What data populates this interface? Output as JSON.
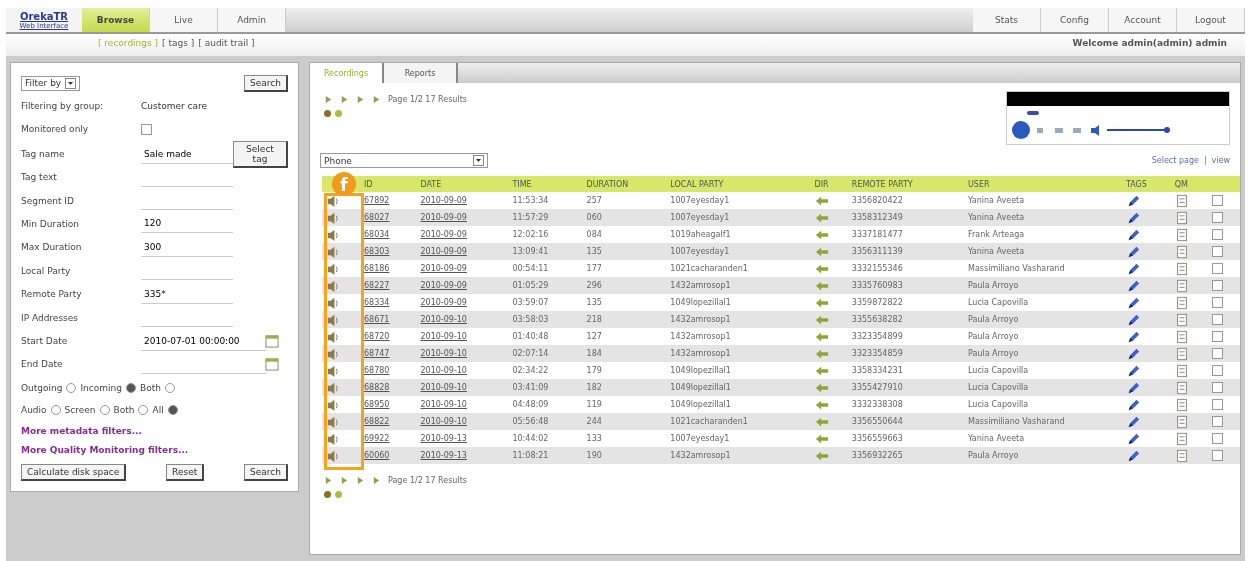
{
  "logo": {
    "name": "OrekaTR",
    "subtitle": "Web Interface"
  },
  "main_tabs": [
    {
      "label": "Browse",
      "selected": true
    },
    {
      "label": "Live",
      "selected": false
    },
    {
      "label": "Admin",
      "selected": false
    }
  ],
  "right_tabs": [
    {
      "label": "Stats"
    },
    {
      "label": "Config"
    },
    {
      "label": "Account"
    },
    {
      "label": "Logout"
    }
  ],
  "sub_nav": [
    {
      "label": "[ recordings ]",
      "selected": true
    },
    {
      "label": "[ tags ]",
      "selected": false
    },
    {
      "label": "[ audit trail ]",
      "selected": false
    }
  ],
  "welcome": "Welcome admin(admin) admin",
  "filter_panel": {
    "filter_select": "Filter by",
    "search_button": "Search",
    "fields": [
      {
        "kind": "text",
        "label": "Filtering by group:",
        "value": "Customer care"
      },
      {
        "kind": "checkbox",
        "label": "Monitored only",
        "checked": false
      },
      {
        "kind": "input",
        "label": "Tag name",
        "value": "Sale made",
        "button": "Select tag"
      },
      {
        "kind": "input",
        "label": "Tag text"
      },
      {
        "kind": "input",
        "label": "Segment ID"
      },
      {
        "kind": "input",
        "label": "Min Duration",
        "value": "120"
      },
      {
        "kind": "input",
        "label": "Max Duration",
        "value": "300"
      },
      {
        "kind": "input",
        "label": "Local Party"
      },
      {
        "kind": "input",
        "label": "Remote Party",
        "value": "335*"
      },
      {
        "kind": "input",
        "label": "IP Addresses"
      },
      {
        "kind": "date",
        "label": "Start Date",
        "value": "2010-07-01 00:00:00"
      },
      {
        "kind": "date",
        "label": "End Date"
      }
    ],
    "direction": [
      {
        "label": "Outgoing",
        "selected": false
      },
      {
        "label": "Incoming",
        "selected": true
      },
      {
        "label": "Both",
        "selected": false
      }
    ],
    "media": [
      {
        "label": "Audio",
        "selected": false
      },
      {
        "label": "Screen",
        "selected": false
      },
      {
        "label": "Both",
        "selected": false
      },
      {
        "label": "All",
        "selected": true
      }
    ],
    "links": [
      "More metadata filters...",
      "More Quality Monitoring filters..."
    ],
    "buttons": [
      "Calculate disk space",
      "Reset",
      "Search"
    ]
  },
  "content_tabs": [
    {
      "label": "Recordings",
      "selected": true
    },
    {
      "label": "Reports",
      "selected": false
    }
  ],
  "pagination_top": "Page 1/2 17 Results",
  "pagination_bottom": "Page 1/2 17 Results",
  "view_select": "Phone",
  "table_links": [
    "Select page",
    "view"
  ],
  "link_separator": "|",
  "callout": "f",
  "table": {
    "columns": [
      "",
      "ID",
      "DATE",
      "TIME",
      "DURATION",
      "LOCAL PARTY",
      "DIR",
      "REMOTE PARTY",
      "USER",
      "TAGS",
      "QM",
      ""
    ],
    "rows": [
      {
        "cells": [
          "",
          "67892",
          "2010-09-09",
          "11:53:34",
          "257",
          "1007eyesday1",
          "",
          "3356820422",
          "Yanina Aveeta",
          "",
          "",
          ""
        ],
        "checked": false
      },
      {
        "cells": [
          "",
          "68027",
          "2010-09-09",
          "11:57:29",
          "060",
          "1007eyesday1",
          "",
          "3358312349",
          "Yanina Aveeta",
          "",
          "",
          ""
        ],
        "checked": false
      },
      {
        "cells": [
          "",
          "68034",
          "2010-09-09",
          "12:02:16",
          "084",
          "1019aheagalf1",
          "",
          "3337181477",
          "Frank Arteaga",
          "",
          "",
          ""
        ],
        "checked": false
      },
      {
        "cells": [
          "",
          "68303",
          "2010-09-09",
          "13:09:41",
          "135",
          "1007eyesday1",
          "",
          "3356311139",
          "Yanina Aveeta",
          "",
          "",
          ""
        ],
        "checked": false
      },
      {
        "cells": [
          "",
          "68186",
          "2010-09-09",
          "00:54:11",
          "177",
          "1021cacharanden1",
          "",
          "3332155346",
          "Massimiliano Vasharand",
          "",
          "",
          ""
        ],
        "checked": false
      },
      {
        "cells": [
          "",
          "68227",
          "2010-09-09",
          "01:05:29",
          "296",
          "1432amrosop1",
          "",
          "3335760983",
          "Paula Arroyo",
          "",
          "",
          ""
        ],
        "checked": false
      },
      {
        "cells": [
          "",
          "68334",
          "2010-09-09",
          "03:59:07",
          "135",
          "1049lopezillal1",
          "",
          "3359872822",
          "Lucia Capovilla",
          "",
          "",
          ""
        ],
        "checked": false
      },
      {
        "cells": [
          "",
          "68671",
          "2010-09-10",
          "03:58:03",
          "218",
          "1432amrosop1",
          "",
          "3355638282",
          "Paula Arroyo",
          "",
          "",
          ""
        ],
        "checked": false
      },
      {
        "cells": [
          "",
          "68720",
          "2010-09-10",
          "01:40:48",
          "127",
          "1432amrosop1",
          "",
          "3323354899",
          "Paula Arroyo",
          "",
          "",
          ""
        ],
        "checked": false
      },
      {
        "cells": [
          "",
          "68747",
          "2010-09-10",
          "02:07:14",
          "184",
          "1432amrosop1",
          "",
          "3323354859",
          "Paula Arroyo",
          "",
          "",
          ""
        ],
        "checked": false
      },
      {
        "cells": [
          "",
          "68780",
          "2010-09-10",
          "02:34:22",
          "179",
          "1049lopezillal1",
          "",
          "3358334231",
          "Lucia Capovilla",
          "",
          "",
          ""
        ],
        "checked": false
      },
      {
        "cells": [
          "",
          "68828",
          "2010-09-10",
          "03:41:09",
          "182",
          "1049lopezillal1",
          "",
          "3355427910",
          "Lucia Capovilla",
          "",
          "",
          ""
        ],
        "checked": false
      },
      {
        "cells": [
          "",
          "68950",
          "2010-09-10",
          "04:48:09",
          "119",
          "1049lopezillal1",
          "",
          "3332338308",
          "Lucia Capovilla",
          "",
          "",
          ""
        ],
        "checked": false
      },
      {
        "cells": [
          "",
          "68822",
          "2010-09-10",
          "05:56:48",
          "244",
          "1021cacharanden1",
          "",
          "3356550644",
          "Massimiliano Vasharand",
          "",
          "",
          ""
        ],
        "checked": false
      },
      {
        "cells": [
          "",
          "69922",
          "2010-09-13",
          "10:44:02",
          "133",
          "1007eyesday1",
          "",
          "3356559663",
          "Yanina Aveeta",
          "",
          "",
          ""
        ],
        "checked": false
      },
      {
        "cells": [
          "",
          "60060",
          "2010-09-13",
          "11:08:21",
          "190",
          "1432amrosop1",
          "",
          "3356932265",
          "Paula Arroyo",
          "",
          "",
          ""
        ],
        "checked": false
      }
    ]
  }
}
